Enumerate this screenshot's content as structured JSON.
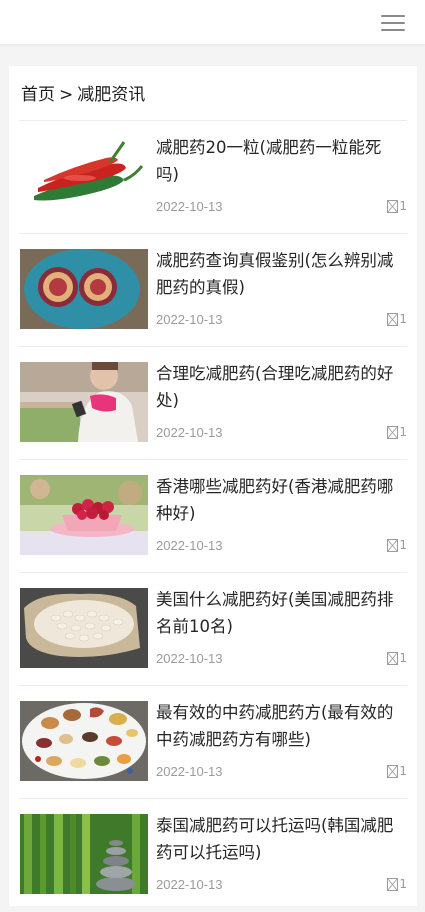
{
  "header": {
    "menu_icon": "hamburger-menu-icon"
  },
  "breadcrumb": {
    "home": "首页",
    "separator": ">",
    "current": "减肥资讯"
  },
  "articles": [
    {
      "title": "减肥药20一粒(减肥药一粒能死吗)",
      "date": "2022-10-13",
      "views": "1",
      "thumb": "red-green-peppers"
    },
    {
      "title": "减肥药查询真假鉴别(怎么辨别减肥药的真假)",
      "date": "2022-10-13",
      "views": "1",
      "thumb": "cut-figs-on-plate"
    },
    {
      "title": "合理吃减肥药(合理吃减肥药的好处)",
      "date": "2022-10-13",
      "views": "1",
      "thumb": "woman-with-phone"
    },
    {
      "title": "香港哪些减肥药好(香港减肥药哪种好)",
      "date": "2022-10-13",
      "views": "1",
      "thumb": "raspberries-in-bowl"
    },
    {
      "title": "美国什么减肥药好(美国减肥药排名前10名)",
      "date": "2022-10-13",
      "views": "1",
      "thumb": "white-beans-in-sack"
    },
    {
      "title": "最有效的中药减肥药方(最有效的中药减肥药方有哪些)",
      "date": "2022-10-13",
      "views": "1",
      "thumb": "herbs-on-tray"
    },
    {
      "title": "泰国减肥药可以托运吗(韩国减肥药可以托运吗)",
      "date": "2022-10-13",
      "views": "1",
      "thumb": "bamboo-and-stones"
    }
  ]
}
